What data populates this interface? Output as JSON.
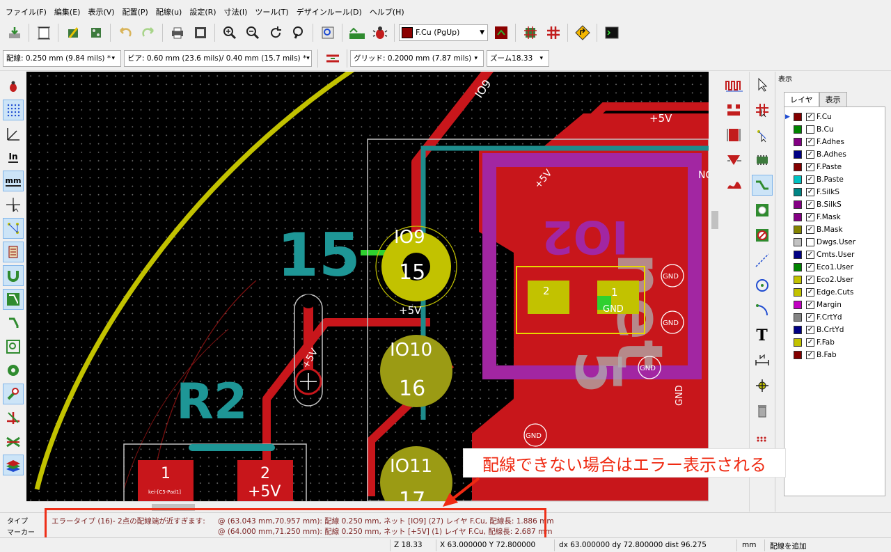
{
  "menu": [
    "ファイル(F)",
    "編集(E)",
    "表示(V)",
    "配置(P)",
    "配線(u)",
    "設定(R)",
    "寸法(I)",
    "ツール(T)",
    "デザインルール(D)",
    "ヘルプ(H)"
  ],
  "toolbar": {
    "layer_select": "F.Cu (PgUp)"
  },
  "options": {
    "track": "配線: 0.250 mm (9.84 mils) *",
    "via": "ビア: 0.60 mm (23.6 mils)/ 0.40 mm (15.7 mils) *",
    "grid": "グリッド: 0.2000 mm (7.87 mils)",
    "zoom": "ズーム18.33"
  },
  "left_tools": {
    "in_label": "In",
    "mm_label": "mm"
  },
  "right_tools": {
    "text_tool": "T"
  },
  "board": {
    "net_io9_top": "IO9",
    "net_plus5v_top": "+5V",
    "ref_15": "15",
    "pad_io9_label": "IO9",
    "pad_io9_num": "15",
    "net_plus5v_mid": "+5V",
    "pad_io10_label": "IO10",
    "pad_io10_num": "16",
    "pad_io11_label": "IO11",
    "pad_io11_num": "17",
    "ref_r2": "R2",
    "via_net": "+5V",
    "small_pad_1": "1",
    "small_pad_2": "2",
    "small_pad_2_net": "+5V",
    "smd_pad_2": "2",
    "smd_pad_1": "1",
    "smd_pad_1_net": "GND",
    "gnd": "GND",
    "nc": "NC",
    "pad_silk_plus5v": "+5V",
    "fab_ref": "kei-[C5-Pad1]"
  },
  "layer_panel": {
    "title": "表示",
    "tabs": [
      "レイヤ",
      "表示"
    ],
    "layers": [
      {
        "name": "F.Cu",
        "color": "#840000",
        "checked": true,
        "active": true
      },
      {
        "name": "B.Cu",
        "color": "#008400",
        "checked": false
      },
      {
        "name": "F.Adhes",
        "color": "#840084",
        "checked": true
      },
      {
        "name": "B.Adhes",
        "color": "#000084",
        "checked": true
      },
      {
        "name": "F.Paste",
        "color": "#840000",
        "checked": true
      },
      {
        "name": "B.Paste",
        "color": "#00c2c2",
        "checked": true
      },
      {
        "name": "F.SilkS",
        "color": "#008484",
        "checked": true
      },
      {
        "name": "B.SilkS",
        "color": "#840084",
        "checked": true
      },
      {
        "name": "F.Mask",
        "color": "#840084",
        "checked": true
      },
      {
        "name": "B.Mask",
        "color": "#848400",
        "checked": true
      },
      {
        "name": "Dwgs.User",
        "color": "#c2c2c2",
        "checked": false
      },
      {
        "name": "Cmts.User",
        "color": "#000084",
        "checked": true
      },
      {
        "name": "Eco1.User",
        "color": "#008400",
        "checked": true
      },
      {
        "name": "Eco2.User",
        "color": "#c2c200",
        "checked": true
      },
      {
        "name": "Edge.Cuts",
        "color": "#c2c200",
        "checked": true
      },
      {
        "name": "Margin",
        "color": "#c200c2",
        "checked": true
      },
      {
        "name": "F.CrtYd",
        "color": "#848484",
        "checked": true
      },
      {
        "name": "B.CrtYd",
        "color": "#000084",
        "checked": true
      },
      {
        "name": "F.Fab",
        "color": "#c2c200",
        "checked": true
      },
      {
        "name": "B.Fab",
        "color": "#840000",
        "checked": true
      }
    ]
  },
  "messages": {
    "label_type": "タイプ",
    "label_marker": "マーカー",
    "error_type": "エラータイプ (16)- 2点の配線端が近すぎます:",
    "item1": "@ (63.043 mm,70.957 mm): 配線 0.250 mm, ネット [IO9] (27) レイヤ F.Cu, 配線長: 1.886 mm",
    "item2": "@ (64.000 mm,71.250 mm): 配線 0.250 mm, ネット [+5V] (1) レイヤ F.Cu, 配線長: 2.687 mm"
  },
  "status": {
    "zoom": "Z 18.33",
    "xy": "X 63.000000  Y 72.800000",
    "dxy": "dx 63.000000  dy 72.800000  dist 96.275",
    "units": "mm",
    "mode": "配線を追加"
  },
  "annotation": {
    "text": "配線できない場合はエラー表示される"
  }
}
